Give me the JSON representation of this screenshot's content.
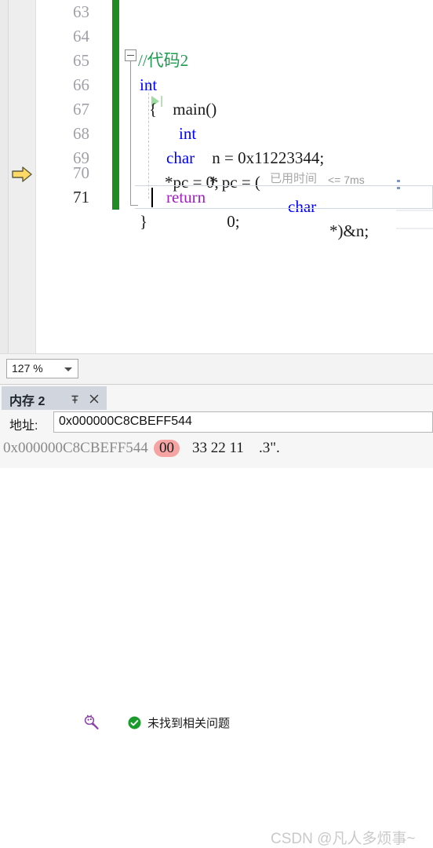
{
  "editor": {
    "lines": [
      {
        "num": "63",
        "segments": []
      },
      {
        "num": "64",
        "segments": [
          {
            "text": "  //代码2",
            "cls": "tok-comment"
          }
        ]
      },
      {
        "num": "65",
        "segments": [
          {
            "text": "int",
            "cls": "tok-kw"
          },
          {
            "text": " main()",
            "cls": "tok-plain"
          }
        ]
      },
      {
        "num": "66",
        "segments": [
          {
            "text": "  {",
            "cls": "tok-plain"
          }
        ]
      },
      {
        "num": "67",
        "segments": [
          {
            "text": "int",
            "cls": "tok-kw"
          },
          {
            "text": " n = 0x11223344;",
            "cls": "tok-plain"
          }
        ]
      },
      {
        "num": "68",
        "segments": [
          {
            "text": "char",
            "cls": "tok-kw"
          },
          {
            "text": "* pc = (",
            "cls": "tok-plain"
          },
          {
            "text": "char",
            "cls": "tok-kw"
          },
          {
            "text": "*)&n;",
            "cls": "tok-plain"
          }
        ]
      },
      {
        "num": "69",
        "segments": [
          {
            "text": "*pc = 0;",
            "cls": "tok-plain"
          }
        ]
      },
      {
        "num": "70",
        "segments": [
          {
            "text": "return",
            "cls": "tok-ret"
          },
          {
            "text": " 0;",
            "cls": "tok-plain"
          }
        ]
      },
      {
        "num": "71",
        "segments": [
          {
            "text": "}",
            "cls": "tok-plain"
          }
        ]
      }
    ],
    "line_64_text": "//代码2",
    "line_65_kw": "int",
    "line_65_rest": " main()",
    "line_66_text": "{",
    "line_67_kw": "int",
    "line_67_rest": " n = 0x11223344;",
    "line_68_kw1": "char",
    "line_68_mid": "* pc = (",
    "line_68_kw2": "char",
    "line_68_end": "*)&n;",
    "line_69_text": "*pc = 0;",
    "line_70_kw": "return",
    "line_70_rest": " 0;",
    "line_70_elapsed_cjk": "已用时间",
    "line_70_elapsed_val": "<= 7ms",
    "line_71_text": "}",
    "numbers": [
      "63",
      "64",
      "65",
      "66",
      "67",
      "68",
      "69",
      "70",
      "71"
    ],
    "current_line": "71",
    "current_statement_line": "70",
    "step_marker_line": "67",
    "colors": {
      "keyword": "#0000FF",
      "comment": "#1F9B4F",
      "return_keyword": "#A020C0",
      "change_bar": "#1E8C22",
      "linenumber": "#A0A0A8",
      "dim_annotation": "#9B9B9B"
    }
  },
  "statusbar": {
    "zoom_value": "127 %",
    "intellicode_icon": "brain-icon",
    "status_icon": "check-circle-icon",
    "status_message": "未找到相关问题"
  },
  "memory_window": {
    "tab_title": "内存 2",
    "pin_icon": "pin-icon",
    "close_icon": "close-icon",
    "address_label": "地址:",
    "address_value": "0x000000C8CBEFF544",
    "row": {
      "address": "0x000000C8CBEFF544",
      "highlighted_byte": "00",
      "bytes": "33 22 11",
      "ascii": ".3\"."
    }
  },
  "watermark": {
    "text": "CSDN @凡人多烦事~"
  }
}
